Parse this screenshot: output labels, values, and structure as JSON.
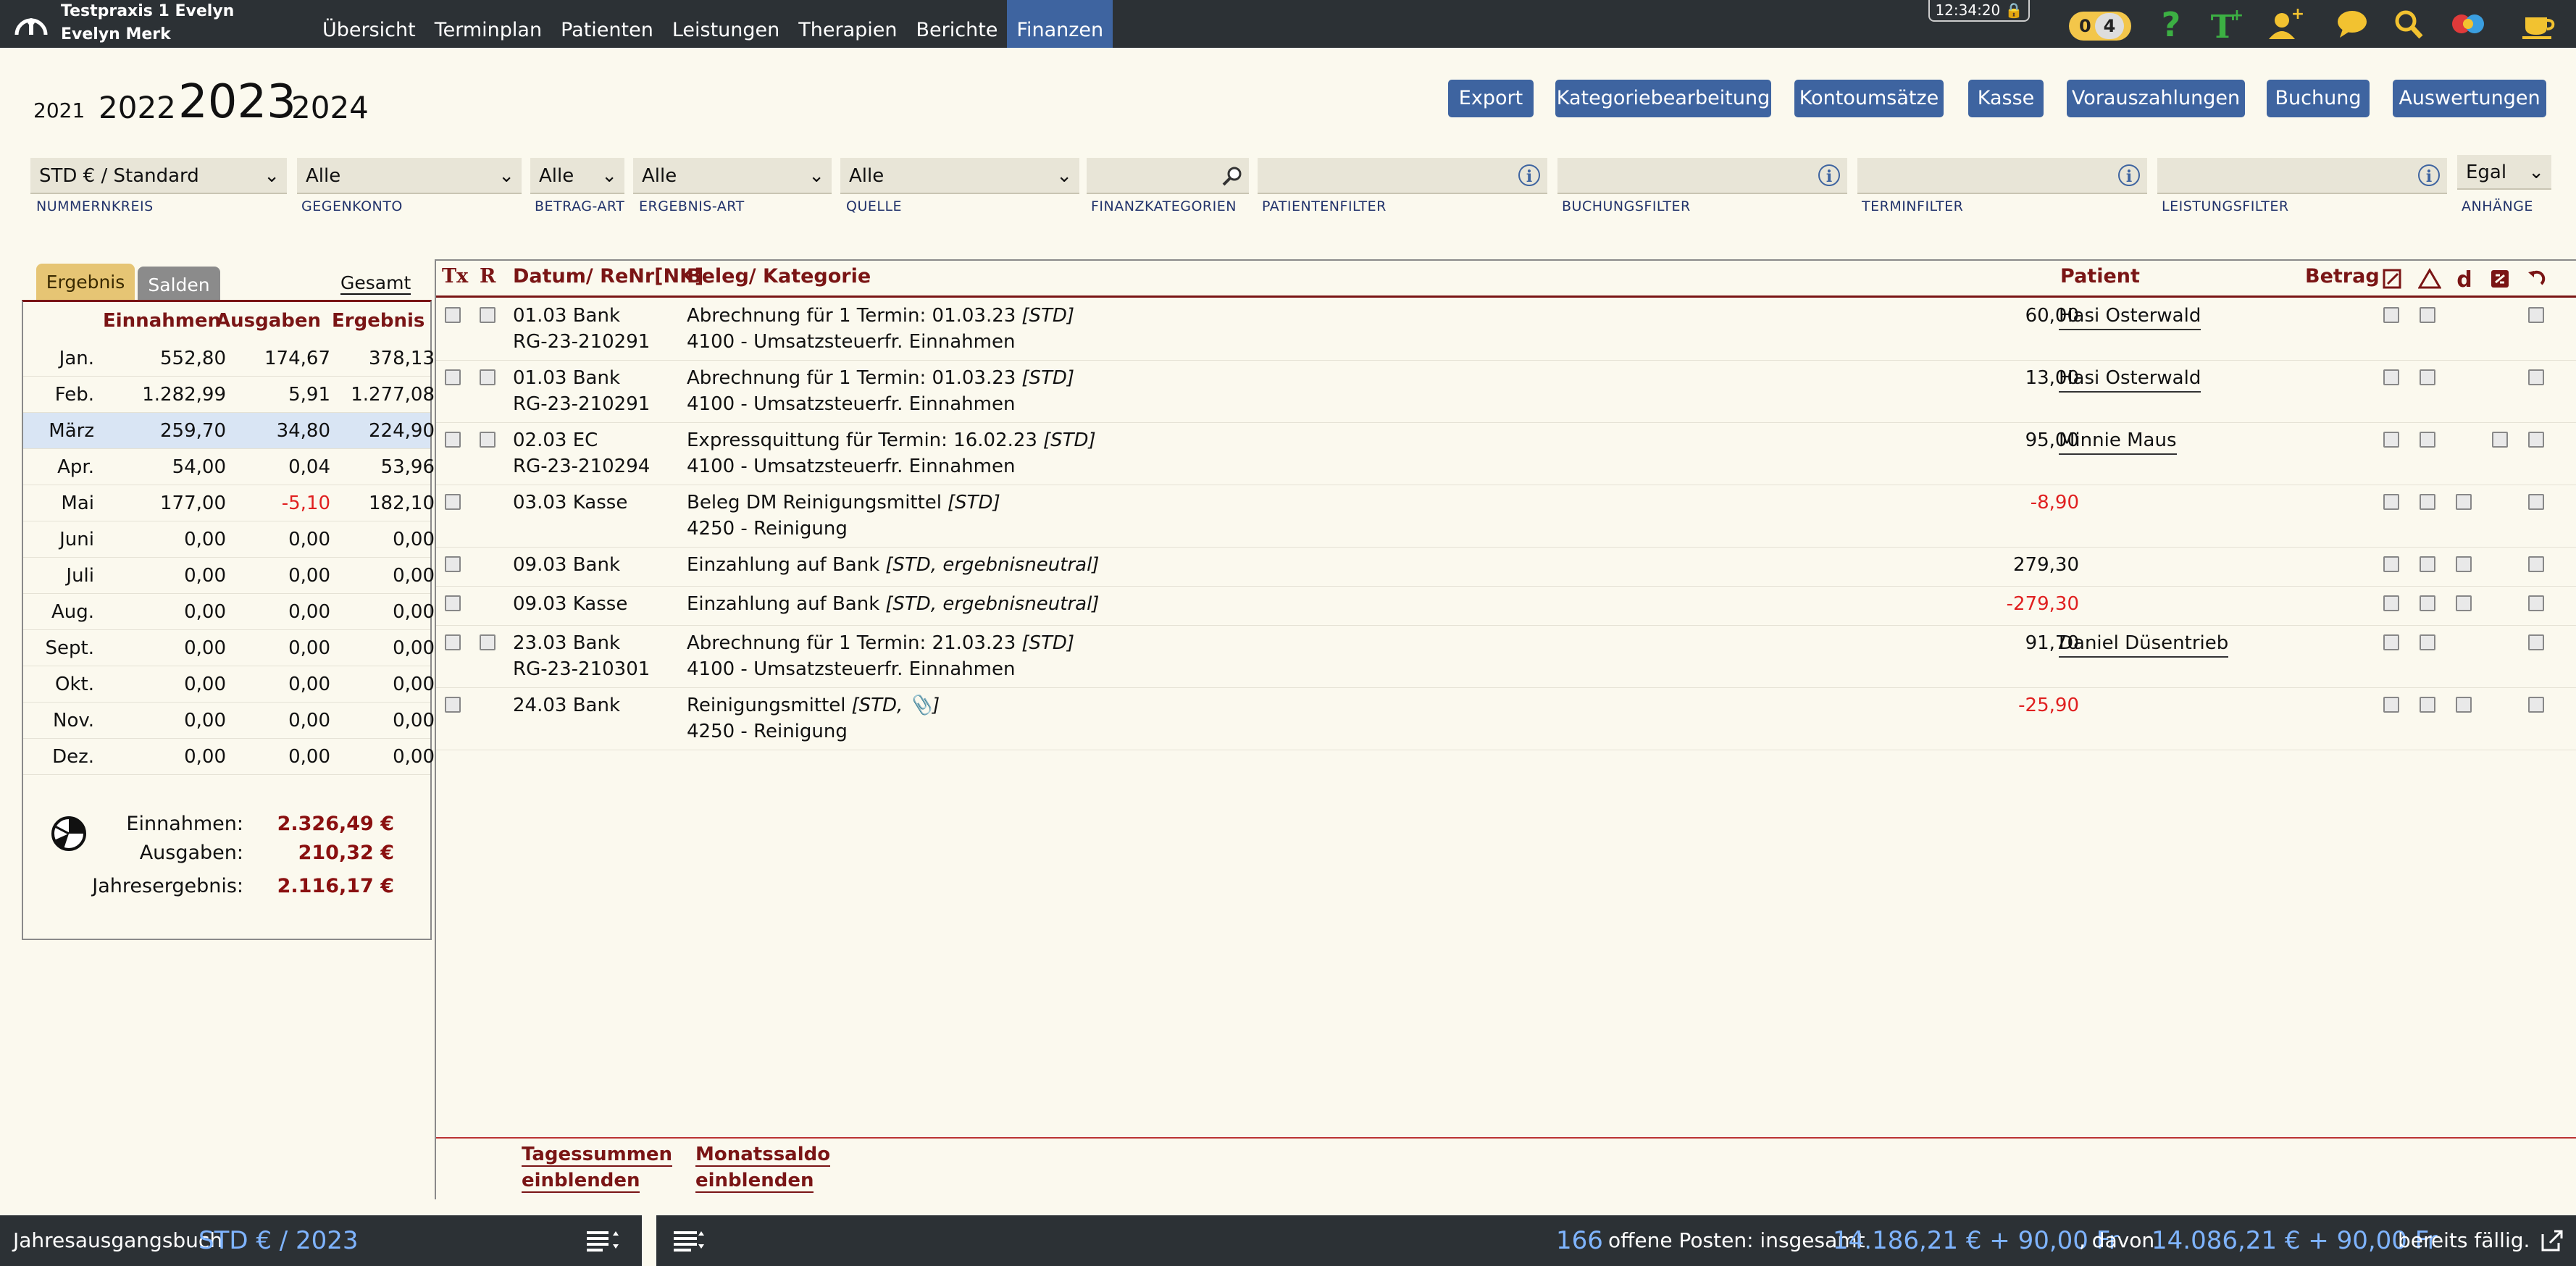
{
  "header": {
    "praxis": "Testpraxis 1 Evelyn",
    "user": "Evelyn Merk",
    "clock": "12:34:20",
    "counter_a": "0",
    "counter_b": "4",
    "nav": [
      "Übersicht",
      "Terminplan",
      "Patienten",
      "Leistungen",
      "Therapien",
      "Berichte",
      "Finanzen"
    ],
    "active_nav": "Finanzen"
  },
  "years": [
    "2021",
    "2022",
    "2023",
    "2024"
  ],
  "selected_year": "2023",
  "toolbar": {
    "buttons": [
      "Export",
      "Kategoriebearbeitung",
      "Kontoumsätze",
      "Kasse",
      "Vorauszahlungen",
      "Buchung",
      "Auswertungen"
    ]
  },
  "filters": {
    "nummernkreis": {
      "value": "STD € / Standard",
      "label": "NUMMERNKREIS"
    },
    "gegenkonto": {
      "value": "Alle",
      "label": "GEGENKONTO"
    },
    "betrag_art": {
      "value": "Alle",
      "label": "BETRAG-ART"
    },
    "ergebnis_art": {
      "value": "Alle",
      "label": "ERGEBNIS-ART"
    },
    "quelle": {
      "value": "Alle",
      "label": "QUELLE"
    },
    "finanzkategorien": {
      "value": "",
      "label": "FINANZKATEGORIEN"
    },
    "patientenfilter": {
      "value": "",
      "label": "PATIENTENFILTER"
    },
    "buchungsfilter": {
      "value": "",
      "label": "BUCHUNGSFILTER"
    },
    "terminfilter": {
      "value": "",
      "label": "TERMINFILTER"
    },
    "leistungsfilter": {
      "value": "",
      "label": "LEISTUNGSFILTER"
    },
    "anhaenge": {
      "value": "Egal",
      "label": "ANHÄNGE"
    }
  },
  "left_panel": {
    "tab_ergebnis": "Ergebnis",
    "tab_salden": "Salden",
    "gesamt": "Gesamt",
    "headers": [
      "Einnahmen",
      "Ausgaben",
      "Ergebnis"
    ],
    "months": [
      {
        "m": "Jan.",
        "e": "552,80",
        "a": "174,67",
        "r": "378,13"
      },
      {
        "m": "Feb.",
        "e": "1.282,99",
        "a": "5,91",
        "r": "1.277,08"
      },
      {
        "m": "März",
        "e": "259,70",
        "a": "34,80",
        "r": "224,90"
      },
      {
        "m": "Apr.",
        "e": "54,00",
        "a": "0,04",
        "r": "53,96"
      },
      {
        "m": "Mai",
        "e": "177,00",
        "a": "-5,10",
        "r": "182,10"
      },
      {
        "m": "Juni",
        "e": "0,00",
        "a": "0,00",
        "r": "0,00"
      },
      {
        "m": "Juli",
        "e": "0,00",
        "a": "0,00",
        "r": "0,00"
      },
      {
        "m": "Aug.",
        "e": "0,00",
        "a": "0,00",
        "r": "0,00"
      },
      {
        "m": "Sept.",
        "e": "0,00",
        "a": "0,00",
        "r": "0,00"
      },
      {
        "m": "Okt.",
        "e": "0,00",
        "a": "0,00",
        "r": "0,00"
      },
      {
        "m": "Nov.",
        "e": "0,00",
        "a": "0,00",
        "r": "0,00"
      },
      {
        "m": "Dez.",
        "e": "0,00",
        "a": "0,00",
        "r": "0,00"
      }
    ],
    "selected_month": "März",
    "summary": {
      "einnahmen_label": "Einnahmen:",
      "einnahmen": "2.326,49 €",
      "ausgaben_label": "Ausgaben:",
      "ausgaben": "210,32 €",
      "ergebnis_label": "Jahresergebnis:",
      "ergebnis": "2.116,17 €"
    }
  },
  "table": {
    "headers": {
      "tx": "Tx",
      "r": "R",
      "datum": "Datum/ ReNr[NK]",
      "beleg": "Beleg/ Kategorie",
      "patient": "Patient",
      "betrag": "Betrag"
    },
    "rows": [
      {
        "datum": "01.03 Bank",
        "renr": "RG-23-210291",
        "beleg": "Abrechnung für 1 Termin: 01.03.23",
        "tag": "[STD]",
        "kategorie": "4100 - Umsatzsteuerfr. Einnahmen",
        "patient": "Hasi Osterwald",
        "betrag": "60,00",
        "neg": false
      },
      {
        "datum": "01.03 Bank",
        "renr": "RG-23-210291",
        "beleg": "Abrechnung für 1 Termin: 01.03.23",
        "tag": "[STD]",
        "kategorie": "4100 - Umsatzsteuerfr. Einnahmen",
        "patient": "Hasi Osterwald",
        "betrag": "13,00",
        "neg": false
      },
      {
        "datum": "02.03 EC",
        "renr": "RG-23-210294",
        "beleg": "Expressquittung für Termin: 16.02.23",
        "tag": "[STD]",
        "kategorie": "4100 - Umsatzsteuerfr. Einnahmen",
        "patient": "Minnie Maus",
        "betrag": "95,00",
        "neg": false
      },
      {
        "datum": "03.03 Kasse",
        "renr": "",
        "beleg": "Beleg DM Reinigungsmittel",
        "tag": "[STD]",
        "kategorie": "4250 - Reinigung",
        "patient": "",
        "betrag": "-8,90",
        "neg": true
      },
      {
        "datum": "09.03 Bank",
        "renr": "",
        "beleg": "Einzahlung auf Bank",
        "tag": "[STD, ergebnisneutral]",
        "kategorie": "",
        "patient": "",
        "betrag": "279,30",
        "neg": false
      },
      {
        "datum": "09.03 Kasse",
        "renr": "",
        "beleg": "Einzahlung auf Bank",
        "tag": "[STD, ergebnisneutral]",
        "kategorie": "",
        "patient": "",
        "betrag": "-279,30",
        "neg": true
      },
      {
        "datum": "23.03 Bank",
        "renr": "RG-23-210301",
        "beleg": "Abrechnung für 1 Termin: 21.03.23",
        "tag": "[STD]",
        "kategorie": "4100 - Umsatzsteuerfr. Einnahmen",
        "patient": "Daniel Düsentrieb",
        "betrag": "91,70",
        "neg": false
      },
      {
        "datum": "24.03 Bank",
        "renr": "",
        "beleg": "Reinigungsmittel",
        "tag": "[STD, 📎]",
        "kategorie": "4250 - Reinigung",
        "patient": "",
        "betrag": "-25,90",
        "neg": true
      }
    ],
    "footer_links": [
      "Tagessummen einblenden",
      "Monatssaldo einblenden"
    ]
  },
  "statusbar": {
    "label": "Jahresausgangsbuch",
    "value": "STD € / 2023",
    "count": "166",
    "text1": "offene Posten: insgesamt",
    "total": "14.186,21 € + 90,00 Fr",
    "text2": ", davon",
    "due": "14.086,21 € + 90,00 Fr",
    "text3": "bereits fällig."
  },
  "colors": {
    "accent": "#3e64a0",
    "header_red": "#7a1515",
    "negative": "#e02020",
    "bar_dark": "#2c3135",
    "background": "#fbf9ee"
  }
}
